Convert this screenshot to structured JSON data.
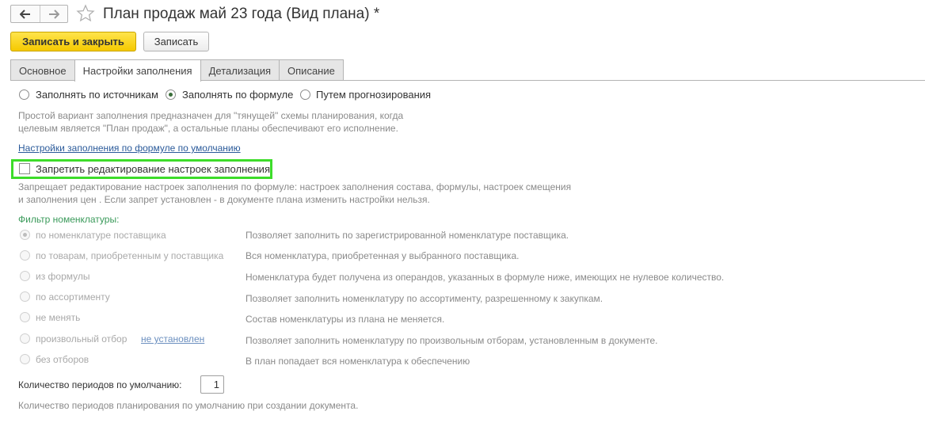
{
  "window": {
    "title": "План продаж май 23 года (Вид плана) *"
  },
  "toolbar": {
    "save_close_label": "Записать и закрыть",
    "save_label": "Записать"
  },
  "tabs": [
    {
      "label": "Основное",
      "active": false
    },
    {
      "label": "Настройки заполнения",
      "active": true
    },
    {
      "label": "Детализация",
      "active": false
    },
    {
      "label": "Описание",
      "active": false
    }
  ],
  "fill_mode": {
    "options": [
      {
        "label": "Заполнять по источникам",
        "selected": false
      },
      {
        "label": "Заполнять по формуле",
        "selected": true
      },
      {
        "label": "Путем прогнозирования",
        "selected": false
      }
    ],
    "description_line1": "Простой вариант заполнения предназначен для \"тянущей\" схемы планирования, когда",
    "description_line2": "целевым является \"План продаж\", а остальные планы обеспечивают его исполнение."
  },
  "default_formula_link": "Настройки заполнения по формуле по умолчанию",
  "prohibit_edit": {
    "label": "Запретить редактирование настроек заполнения",
    "checked": false,
    "description_line1": "Запрещает редактирование настроек заполнения по формуле: настроек заполнения состава, формулы, настроек смещения",
    "description_line2": "и заполнения цен . Если запрет установлен - в документе плана изменить настройки нельзя."
  },
  "nomenclature_filter": {
    "heading": "Фильтр номенклатуры:",
    "options": [
      {
        "label": "по номенклатуре поставщика",
        "desc": "Позволяет заполнить по зарегистрированной номенклатуре поставщика.",
        "selected": true
      },
      {
        "label": "по товарам, приобретенным у поставщика",
        "desc": "Вся номенклатура, приобретенная у выбранного поставщика.",
        "selected": false
      },
      {
        "label": "из формулы",
        "desc": "Номенклатура будет получена из операндов, указанных в формуле ниже, имеющих не нулевое количество.",
        "selected": false
      },
      {
        "label": "по ассортименту",
        "desc": "Позволяет заполнить номенклатуру по ассортименту, разрешенному к закупкам.",
        "selected": false
      },
      {
        "label": "не менять",
        "desc": "Состав номенклатуры из плана не меняется.",
        "selected": false
      },
      {
        "label": "произвольный отбор",
        "link": "не установлен",
        "desc": "Позволяет заполнить номенклатуру по произвольным отборам, установленным в документе.",
        "selected": false
      },
      {
        "label": "без отборов",
        "desc": "В план попадает вся номенклатура к обеспечению",
        "selected": false
      }
    ]
  },
  "periods": {
    "label": "Количество периодов по умолчанию:",
    "value": "1",
    "description": "Количество периодов планирования по умолчанию при создании документа."
  },
  "colors": {
    "primary_button": "#f5c900",
    "highlight_border": "#3ddc2a",
    "link": "#2a5a9a",
    "filter_heading": "#3a9a5a"
  }
}
